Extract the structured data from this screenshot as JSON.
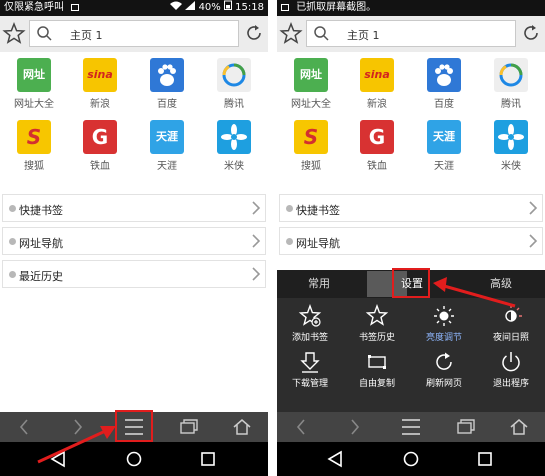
{
  "left_screen": {
    "status": {
      "left_text": "仅限紧急呼叫",
      "battery": "40%",
      "time": "15:18"
    },
    "address": {
      "text": "主页 1"
    },
    "tiles": [
      {
        "label": "网址大全",
        "icon_text": "网址",
        "color": "#4caf50"
      },
      {
        "label": "新浪",
        "icon_text": "sina",
        "color": "#f7c500"
      },
      {
        "label": "百度",
        "icon_text": "",
        "color": "#2f78d6"
      },
      {
        "label": "腾讯",
        "icon_text": "",
        "color": "#eeeeee"
      },
      {
        "label": "搜狐",
        "icon_text": "S",
        "color": "#f7c600"
      },
      {
        "label": "铁血",
        "icon_text": "G",
        "color": "#d83232"
      },
      {
        "label": "天涯",
        "icon_text": "天涯",
        "color": "#2fa3e6"
      },
      {
        "label": "米侠",
        "icon_text": "",
        "color": "#1e9fe0"
      }
    ],
    "list": [
      "快捷书签",
      "网址导航",
      "最近历史"
    ]
  },
  "right_screen": {
    "status": {
      "left_text": "已抓取屏幕截图。"
    },
    "address": {
      "text": "主页 1"
    },
    "tiles": [
      {
        "label": "网址大全",
        "icon_text": "网址"
      },
      {
        "label": "新浪",
        "icon_text": "sina"
      },
      {
        "label": "百度",
        "icon_text": ""
      },
      {
        "label": "腾讯",
        "icon_text": ""
      },
      {
        "label": "搜狐",
        "icon_text": "S"
      },
      {
        "label": "铁血",
        "icon_text": "G"
      },
      {
        "label": "天涯",
        "icon_text": "天涯"
      },
      {
        "label": "米侠",
        "icon_text": ""
      }
    ],
    "list": [
      "快捷书签",
      "网址导航"
    ],
    "menu": {
      "tabs": [
        "常用",
        "设置",
        "高级"
      ],
      "active_tab": "设置",
      "items": [
        {
          "label": "添加书签",
          "icon": "star-plus-icon"
        },
        {
          "label": "书签历史",
          "icon": "star-icon"
        },
        {
          "label": "亮度调节",
          "icon": "brightness-icon"
        },
        {
          "label": "夜间日照",
          "icon": "night-mode-icon"
        },
        {
          "label": "下载管理",
          "icon": "download-icon"
        },
        {
          "label": "自由复制",
          "icon": "copy-icon"
        },
        {
          "label": "刷新网页",
          "icon": "refresh-icon"
        },
        {
          "label": "退出程序",
          "icon": "power-icon"
        }
      ]
    }
  },
  "colors": {
    "highlight": "#e11d1d",
    "toolbar": "#444444",
    "menu": "#2d2d2d"
  }
}
